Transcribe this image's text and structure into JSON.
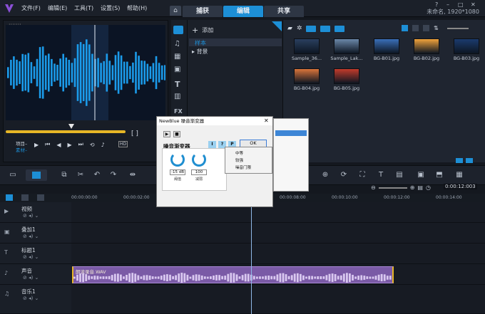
{
  "app": {
    "menu": [
      "文件(F)",
      "编辑(E)",
      "工具(T)",
      "设置(S)",
      "帮助(H)"
    ],
    "tabs": [
      {
        "label": "捕获",
        "active": false
      },
      {
        "label": "编辑",
        "active": true
      },
      {
        "label": "共享",
        "active": false
      }
    ],
    "project_info": "未命名, 1920*1080",
    "window_buttons": [
      "?",
      "–",
      "□",
      "✕"
    ]
  },
  "preview": {
    "mode_project": "项目–",
    "mode_clip": "素材–",
    "clip_label": "HD"
  },
  "library": {
    "add_label": "添加",
    "list_items": [
      "样本",
      "背景"
    ],
    "selected_item": "样本",
    "thumbnails": [
      {
        "label": "Sample_36...",
        "color": "#2a3f5f"
      },
      {
        "label": "Sample_Lak...",
        "color": "#6b87a8"
      },
      {
        "label": "BG-B01.jpg",
        "color": "#3a6fb8"
      },
      {
        "label": "BG-B02.jpg",
        "color": "#f0a13b"
      },
      {
        "label": "BG-B03.jpg",
        "color": "#1b3b6e"
      },
      {
        "label": "BG-B04.jpg",
        "color": "#d9743a"
      },
      {
        "label": "BG-B05.jpg",
        "color": "#c23b2b"
      }
    ]
  },
  "timeline": {
    "timecode": "0:00:12:003",
    "ruler": [
      "00:00:00:00",
      "00:00:02:00",
      "00:00:04:00",
      "00:00:06:00",
      "00:00:08:00",
      "00:00:10:00",
      "00:00:12:00",
      "00:00:14:00"
    ],
    "tracks": [
      {
        "name": "视频"
      },
      {
        "name": "叠加1"
      },
      {
        "name": "标题1"
      },
      {
        "name": "声音"
      },
      {
        "name": "音乐1"
      }
    ],
    "audio_clip": "朗读录音.WAV"
  },
  "dialog": {
    "title": "NewBlue 噪音渐变器",
    "close": "✕",
    "play": "▶",
    "stop": "■",
    "section": "噪音渐变器",
    "help_buttons": [
      "I",
      "?",
      "P"
    ],
    "ok": "OK",
    "knob1_value": "-15 dB",
    "knob1_label": "阈值",
    "knob2_value": "100",
    "knob2_label": "减弱",
    "presets": [
      "中等",
      "较强",
      "噪音门限"
    ]
  },
  "colors": {
    "accent": "#1d8fd6",
    "waveform": "#1b9bea",
    "clip": "#7a5aa6",
    "handle": "#e6b626"
  }
}
